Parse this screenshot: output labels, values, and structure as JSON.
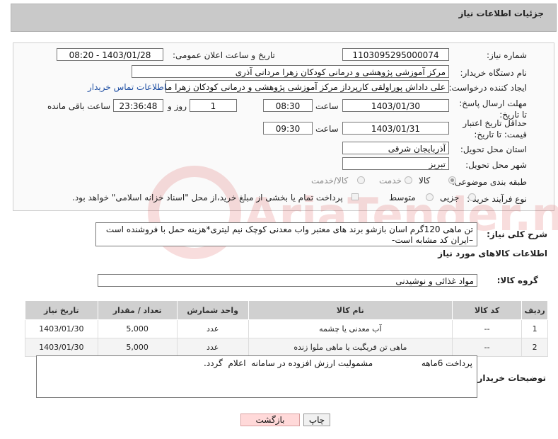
{
  "header": {
    "title": "جزئیات اطلاعات نیاز"
  },
  "form": {
    "need_number_label": "شماره نیاز:",
    "need_number": "1103095295000074",
    "announce_label": "تاریخ و ساعت اعلان عمومی:",
    "announce_value": "1403/01/28 - 08:20",
    "buyer_org_label": "نام دستگاه خریدار:",
    "buyer_org": "مرکز آموزشی پژوهشی و درمانی کودکان زهرا مردانی آذری",
    "requester_label": "ایجاد کننده درخواست:",
    "requester": "علی داداش پوراولقی کارپرداز مرکز آموزشی پژوهشی و درمانی کودکان زهرا مردانی آذری",
    "contact_link": "اطلاعات تماس خریدار",
    "reply_deadline_label": "مهلت ارسال پاسخ: تا تاریخ:",
    "reply_date": "1403/01/30",
    "hour_label": "ساعت",
    "reply_time": "08:30",
    "days_value": "1",
    "days_label": "روز و",
    "remaining_time": "23:36:48",
    "remaining_label": "ساعت باقی مانده",
    "price_deadline_label": "حداقل تاریخ اعتبار قیمت: تا تاریخ:",
    "price_date": "1403/01/31",
    "hour_label2": "ساعت",
    "price_time": "09:30",
    "province_label": "استان محل تحویل:",
    "province": "آذربایجان شرقی",
    "city_label": "شهر محل تحویل:",
    "city": "تبریز",
    "category_label": "طبقه بندی موضوعی:",
    "category_options": [
      "کالا",
      "خدمت",
      "کالا/خدمت"
    ],
    "purchase_type_label": "نوع فرآیند خرید :",
    "purchase_options": [
      "جزیی",
      "متوسط"
    ],
    "payment_note": "پرداخت تمام یا بخشی از مبلغ خرید،از محل \"اسناد خزانه اسلامی\" خواهد بود."
  },
  "description": {
    "label": "شرح کلی نیاز:",
    "text": "تن ماهی 120گرم اسان بازشو برند های معتبر  واب معدنی کوچک نیم لیتری*هزینه حمل با فروشنده است –ایران کد مشابه است-"
  },
  "goods": {
    "section_title": "اطلاعات کالاهای مورد نیاز",
    "group_label": "گروه کالا:",
    "group_value": "مواد غذائی و نوشیدنی",
    "columns": [
      "ردیف",
      "کد کالا",
      "نام کالا",
      "واحد شمارش",
      "تعداد / مقدار",
      "تاریخ نیاز"
    ],
    "rows": [
      {
        "idx": "1",
        "code": "--",
        "name": "آب معدنی یا چشمه",
        "unit": "عدد",
        "qty": "5,000",
        "date": "1403/01/30"
      },
      {
        "idx": "2",
        "code": "--",
        "name": "ماهی تن فریگیت یا ماهی ملوا زنده",
        "unit": "عدد",
        "qty": "5,000",
        "date": "1403/01/30"
      }
    ]
  },
  "buyer_notes": {
    "label": "توضیحات خریدار:",
    "text": "پرداخت 6ماهه                  مشمولیت ارزش افزوده در سامانه  اعلام  گردد."
  },
  "buttons": {
    "print": "چاپ",
    "back": "بازگشت"
  },
  "watermark_text": "AriaTender.neT"
}
